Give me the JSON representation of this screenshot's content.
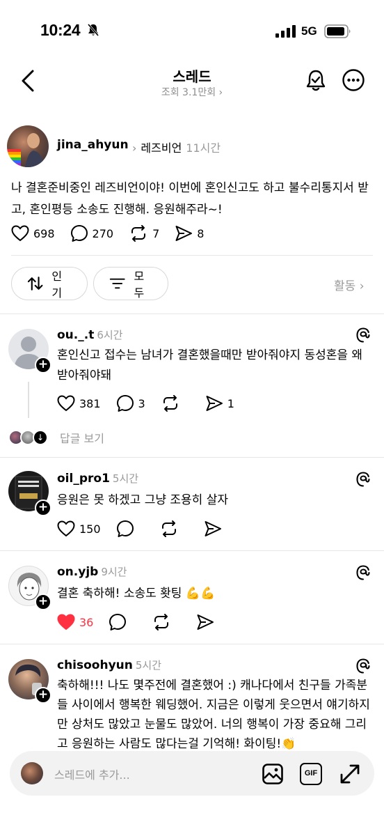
{
  "status": {
    "time": "10:24",
    "network": "5G"
  },
  "header": {
    "title": "스레드",
    "views": "조회 3.1만회 ›"
  },
  "post": {
    "username": "jina_ahyun",
    "topic": "레즈비언",
    "time": "11시간",
    "text": "나 결혼준비중인 레즈비언이야! 이번에 혼인신고도 하고 불수리통지서 받고, 혼인평등 소송도 진행해. 응원해주라~!",
    "likes": "698",
    "comments": "270",
    "reposts": "7",
    "shares": "8"
  },
  "filters": {
    "sort_label": "인기",
    "filter_label": "모두",
    "activity_label": "활동"
  },
  "replies": [
    {
      "username": "ou._.t",
      "time": "6시간",
      "text": "혼인신고 접수는 남녀가 결혼했을때만 받아줘야지  동성혼을 왜 받아줘야돼",
      "likes": "381",
      "comments": "3",
      "reposts": "",
      "shares": "1"
    },
    {
      "username": "oil_pro1",
      "time": "5시간",
      "text": "응원은 못 하겠고 그냥 조용히 살자",
      "likes": "150",
      "comments": "",
      "reposts": "",
      "shares": ""
    },
    {
      "username": "on.yjb",
      "time": "9시간",
      "text": "결혼 축하해! 소송도 홧팅 💪💪",
      "likes": "36",
      "comments": "",
      "reposts": "",
      "shares": ""
    },
    {
      "username": "chisoohyun",
      "time": "5시간",
      "text": "축하해!!! 나도 몇주전에 결혼했어 :) 캐나다에서 친구들 가족분들 사이에서 행복한 웨딩했어. 지금은 이렇게 웃으면서 얘기하지만 상처도 많았고 눈물도 많았어. 너의 행복이 가장 중요해 그리고 응원하는 사람도 많다는걸 기억해! 화이팅!👏"
    }
  ],
  "see_replies_label": "답글 보기",
  "composer": {
    "placeholder": "스레드에 추가...",
    "gif_label": "GIF"
  },
  "colors": {
    "like_active": "#ff3040",
    "muted": "#999999",
    "divider": "#e6e6e6"
  }
}
